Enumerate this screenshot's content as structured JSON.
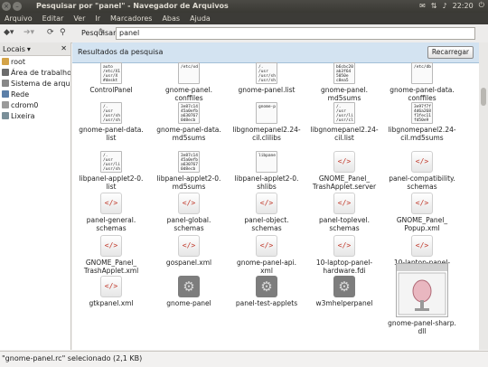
{
  "window": {
    "title": "Pesquisar por \"panel\" - Navegador de Arquivos",
    "clock": "22:20"
  },
  "menu": [
    "Arquivo",
    "Editar",
    "Ver",
    "Ir",
    "Marcadores",
    "Abas",
    "Ajuda"
  ],
  "toolbar": {
    "search_label": "Pesquisar:",
    "search_value": "panel"
  },
  "sidebar": {
    "header": "Locais",
    "items": [
      {
        "label": "root",
        "color": "#d4a348"
      },
      {
        "label": "Área de trabalho",
        "color": "#6c6c6c"
      },
      {
        "label": "Sistema de arqui...",
        "color": "#888888"
      },
      {
        "label": "Rede",
        "color": "#5b7fa8"
      },
      {
        "label": "cdrom0",
        "color": "#9a9a9a"
      },
      {
        "label": "Lixeira",
        "color": "#7a8f99"
      }
    ]
  },
  "infobar": {
    "label": "Resultados da pesquisa",
    "button": "Recarregar"
  },
  "files": [
    {
      "name": "ControlPanel",
      "type": "doc",
      "thumb": "auto\n/etc/X1\n/usr/X\n#deskt"
    },
    {
      "name": "gnome-panel.\nconffiles",
      "type": "doc",
      "thumb": "/etc/xd"
    },
    {
      "name": "gnome-panel.list",
      "type": "doc",
      "thumb": "/.\n/usr\n/usr/sh\n/usr/sh"
    },
    {
      "name": "gnome-panel.\nmd5sums",
      "type": "doc",
      "thumb": "b6cbc20\nab3f64\n5050e\nc8ea5"
    },
    {
      "name": "gnome-panel-data.\nconffiles",
      "type": "doc",
      "thumb": "/etc/db"
    },
    {
      "name": "gnome-panel-data.\nlist",
      "type": "doc",
      "thumb": "/.\n/usr\n/usr/sh\n/usr/sh"
    },
    {
      "name": "gnome-panel-data.\nmd5sums",
      "type": "doc",
      "thumb": "3e87c14\n45a0efb\na630767\n0d8ecb"
    },
    {
      "name": "libgnomepanel2.24-\ncil.clilibs",
      "type": "doc",
      "thumb": "gnome-p"
    },
    {
      "name": "libgnomepanel2.24-\ncil.list",
      "type": "doc",
      "thumb": "/.\n/usr\n/usr/li\n/usr/cl"
    },
    {
      "name": "libgnomepanel2.24-\ncil.md5sums",
      "type": "doc",
      "thumb": "3e97f7f\n4d6a268\nf1fec11\nfd50e9"
    },
    {
      "name": "libpanel-applet2-0.\nlist",
      "type": "doc",
      "thumb": "/.\n/usr\n/usr/li\n/usr/sh"
    },
    {
      "name": "libpanel-applet2-0.\nmd5sums",
      "type": "doc",
      "thumb": "3e87c14\n45a0efb\na630767\n0d8ecb"
    },
    {
      "name": "libpanel-applet2-0.\nshlibs",
      "type": "doc",
      "thumb": "libpane"
    },
    {
      "name": "GNOME_Panel_\nTrashApplet.server",
      "type": "code"
    },
    {
      "name": "panel-compatibility.\nschemas",
      "type": "code"
    },
    {
      "name": "panel-general.\nschemas",
      "type": "code"
    },
    {
      "name": "panel-global.\nschemas",
      "type": "code"
    },
    {
      "name": "panel-object.\nschemas",
      "type": "code"
    },
    {
      "name": "panel-toplevel.\nschemas",
      "type": "code"
    },
    {
      "name": "GNOME_Panel_\nPopup.xml",
      "type": "code"
    },
    {
      "name": "GNOME_Panel_\nTrashApplet.xml",
      "type": "code"
    },
    {
      "name": "gospanel.xml",
      "type": "code"
    },
    {
      "name": "gnome-panel-api.\nxml",
      "type": "code"
    },
    {
      "name": "10-laptop-panel-\nhardware.fdi",
      "type": "code"
    },
    {
      "name": "10-laptop-panel-\nmgmt-policy.fdi",
      "type": "code"
    },
    {
      "name": "gtkpanel.xml",
      "type": "code"
    },
    {
      "name": "gnome-panel",
      "type": "exec"
    },
    {
      "name": "panel-test-applets",
      "type": "exec"
    },
    {
      "name": "w3mhelperpanel",
      "type": "exec"
    },
    {
      "name": "gnome-panel-sharp.\ndll",
      "type": "img"
    }
  ],
  "status": "\"gnome-panel.rc\" selecionado (2,1 KB)"
}
